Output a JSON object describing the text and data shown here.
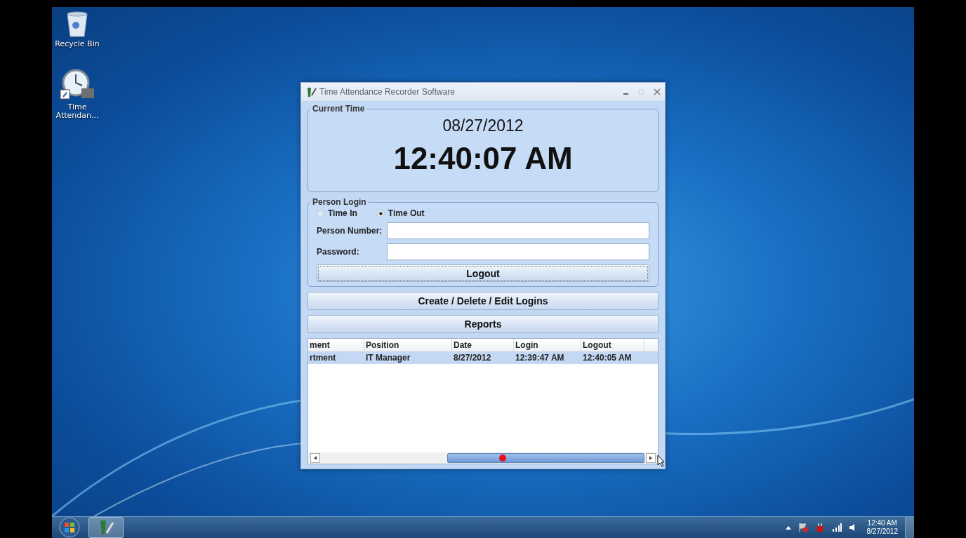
{
  "desktop_icons": [
    {
      "label": "Recycle Bin",
      "kind": "bin"
    },
    {
      "label": "Time Attendan...",
      "kind": "clock"
    }
  ],
  "window": {
    "title": "Time Attendance Recorder Software",
    "current_time": {
      "legend": "Current Time",
      "date": "08/27/2012",
      "time": "12:40:07 AM"
    },
    "person_login": {
      "legend": "Person Login",
      "mode_options": [
        {
          "label": "Time In",
          "selected": false
        },
        {
          "label": "Time Out",
          "selected": true
        }
      ],
      "fields": [
        {
          "label": "Person Number:"
        },
        {
          "label": "Password:"
        }
      ],
      "action_button": "Logout"
    },
    "buttons": [
      "Create / Delete / Edit Logins",
      "Reports"
    ],
    "table": {
      "columns": [
        "ment",
        "Position",
        "Date",
        "Login",
        "Logout"
      ],
      "rows": [
        {
          "cells": [
            "rtment",
            "IT Manager",
            "8/27/2012",
            "12:39:47 AM",
            "12:40:05 AM"
          ],
          "selected": true
        }
      ]
    }
  },
  "taskbar": {
    "clock_time": "12:40 AM",
    "clock_date": "8/27/2012"
  }
}
